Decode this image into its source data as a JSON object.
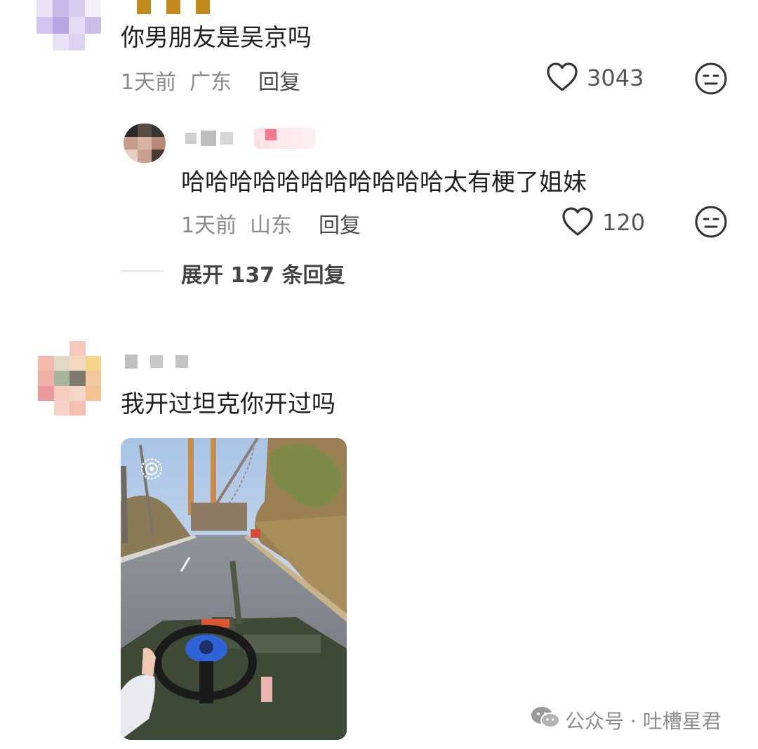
{
  "comment1": {
    "text": "你男朋友是吴京吗",
    "time": "1天前",
    "location": "广东",
    "reply_label": "回复",
    "likes": "3043",
    "colors": {
      "avatar_tint": "#c9b8ea"
    }
  },
  "reply1": {
    "text": "哈哈哈哈哈哈哈哈哈哈哈太有梗了姐妹",
    "time": "1天前",
    "location": "山东",
    "reply_label": "回复",
    "likes": "120"
  },
  "expand": {
    "label": "展开 137 条回复"
  },
  "comment2": {
    "text": "我开过坦克你开过吗",
    "image_subject": "tank-driving-photo",
    "colors": {
      "avatar_tint": "#f2b6a4"
    }
  },
  "watermark": {
    "text": "公众号 · 吐槽星君",
    "icon": "wechat-icon"
  },
  "icons": {
    "like": "heart-outline-icon",
    "dislike": "neutral-face-icon",
    "live_photo": "live-photo-icon"
  }
}
